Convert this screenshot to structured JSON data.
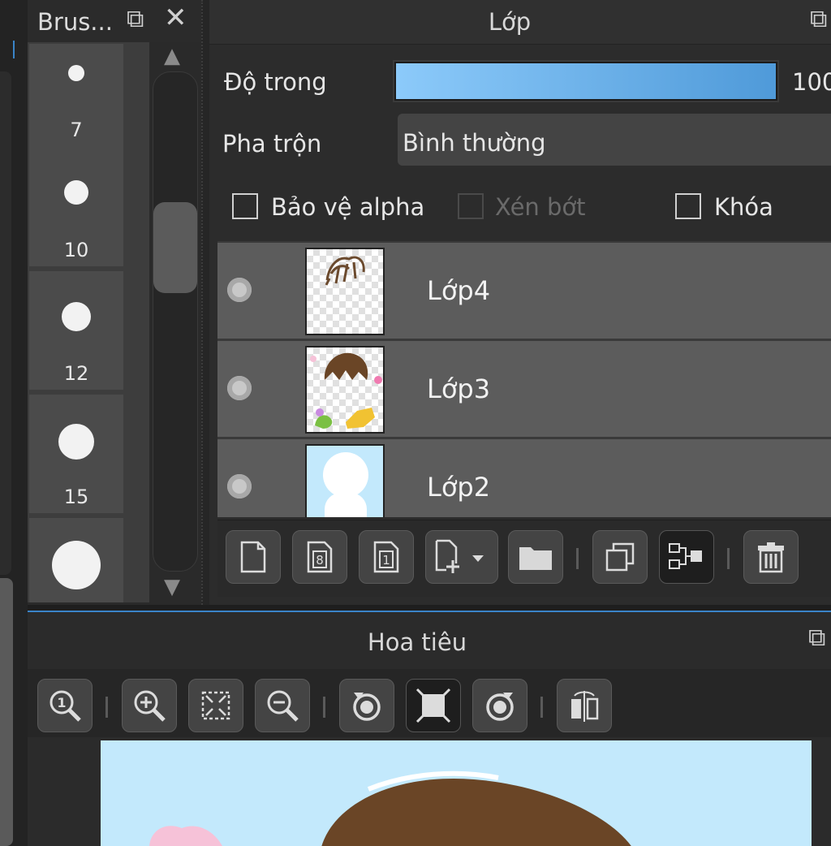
{
  "brush_panel": {
    "title": "Brus...",
    "popout_icon": "popout-icon",
    "close_icon": "close-icon",
    "sizes": [
      "7",
      "10",
      "12",
      "15"
    ]
  },
  "layer_panel": {
    "title": "Lớp",
    "opacity": {
      "label": "Độ trong",
      "value": 100,
      "value_text": "100"
    },
    "blend": {
      "label": "Pha trộn",
      "value": "Bình thường"
    },
    "checkboxes": [
      {
        "label": "Bảo vệ alpha",
        "checked": false,
        "enabled": true
      },
      {
        "label": "Xén bớt",
        "checked": false,
        "enabled": false
      },
      {
        "label": "Khóa",
        "checked": false,
        "enabled": true
      }
    ],
    "layers": [
      {
        "name": "Lớp4",
        "visible": true
      },
      {
        "name": "Lớp3",
        "visible": true
      },
      {
        "name": "Lớp2",
        "visible": true
      }
    ],
    "toolbar_icons": [
      "new-layer-icon",
      "new-8bit-layer-icon",
      "new-1bit-layer-icon",
      "add-layer-dropdown-icon",
      "folder-icon",
      "duplicate-layer-icon",
      "merge-layer-icon",
      "delete-layer-icon"
    ]
  },
  "navigator_panel": {
    "title": "Hoa tiêu",
    "toolbar_icons": [
      "zoom-actual-icon",
      "zoom-in-icon",
      "fit-screen-icon",
      "zoom-out-icon",
      "rotate-left-icon",
      "rotate-reset-icon",
      "rotate-right-icon",
      "flip-horizontal-icon"
    ]
  },
  "colors": {
    "accent": "#3a84c8",
    "opacity_fill_start": "#8ccafa",
    "opacity_fill_end": "#4f9ad9",
    "canvas_bg": "#c3e9fc"
  }
}
